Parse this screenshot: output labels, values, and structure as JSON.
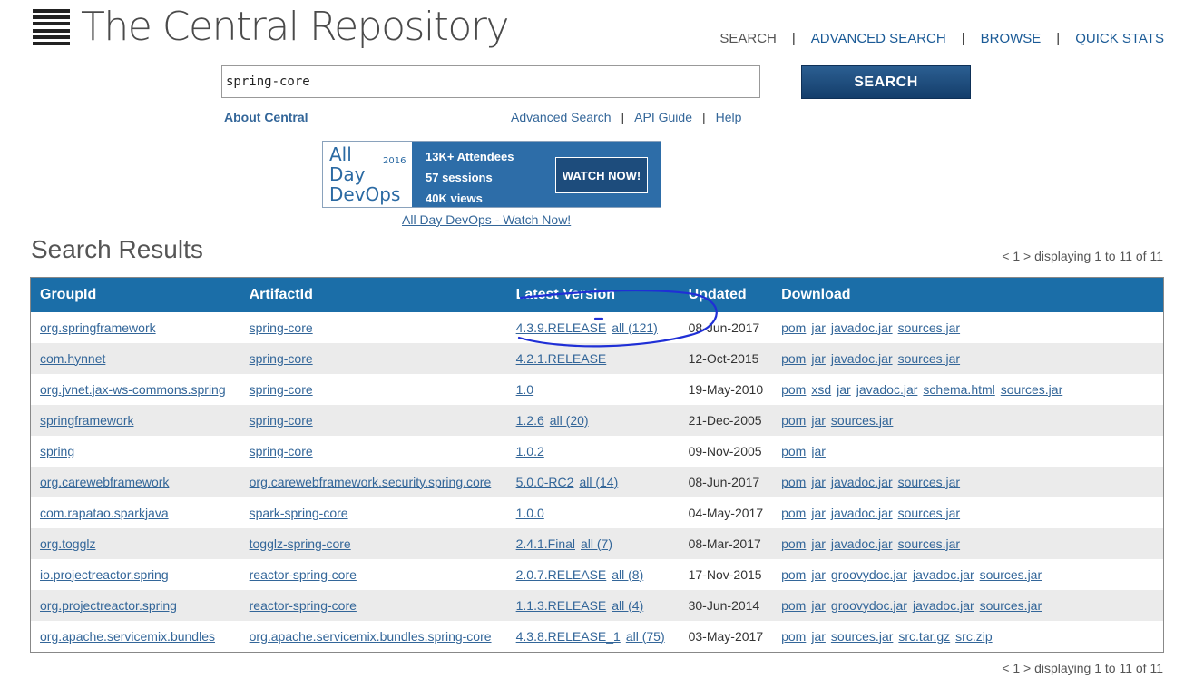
{
  "header": {
    "site_title": "The Central Repository",
    "nav": [
      "SEARCH",
      "ADVANCED SEARCH",
      "BROWSE",
      "QUICK STATS"
    ]
  },
  "search": {
    "value": "spring-core",
    "button_label": "SEARCH"
  },
  "links": {
    "about": "About Central",
    "advanced": "Advanced Search",
    "api": "API Guide",
    "help": "Help"
  },
  "banner": {
    "logo_line1": "All",
    "logo_line2": "Day",
    "logo_line3": "DevOps",
    "year": "2016",
    "stat1": "13K+ Attendees",
    "stat2": "57 sessions",
    "stat3": "40K views",
    "cta": "WATCH NOW!",
    "caption": "All Day DevOps - Watch Now!"
  },
  "results": {
    "title": "Search Results",
    "pager": "< 1 > displaying 1 to 11 of 11",
    "columns": [
      "GroupId",
      "ArtifactId",
      "Latest Version",
      "Updated",
      "Download"
    ],
    "rows": [
      {
        "group": "org.springframework",
        "artifact": "spring-core",
        "version": "4.3.9.RELEASE",
        "all": "all (121)",
        "updated": "08-Jun-2017",
        "downloads": [
          "pom",
          "jar",
          "javadoc.jar",
          "sources.jar"
        ]
      },
      {
        "group": "com.hynnet",
        "artifact": "spring-core",
        "version": "4.2.1.RELEASE",
        "all": "",
        "updated": "12-Oct-2015",
        "downloads": [
          "pom",
          "jar",
          "javadoc.jar",
          "sources.jar"
        ]
      },
      {
        "group": "org.jvnet.jax-ws-commons.spring",
        "artifact": "spring-core",
        "version": "1.0",
        "all": "",
        "updated": "19-May-2010",
        "downloads": [
          "pom",
          "xsd",
          "jar",
          "javadoc.jar",
          "schema.html",
          "sources.jar"
        ]
      },
      {
        "group": "springframework",
        "artifact": "spring-core",
        "version": "1.2.6",
        "all": "all (20)",
        "updated": "21-Dec-2005",
        "downloads": [
          "pom",
          "jar",
          "sources.jar"
        ]
      },
      {
        "group": "spring",
        "artifact": "spring-core",
        "version": "1.0.2",
        "all": "",
        "updated": "09-Nov-2005",
        "downloads": [
          "pom",
          "jar"
        ]
      },
      {
        "group": "org.carewebframework",
        "artifact": "org.carewebframework.security.spring.core",
        "version": "5.0.0-RC2",
        "all": "all (14)",
        "updated": "08-Jun-2017",
        "downloads": [
          "pom",
          "jar",
          "javadoc.jar",
          "sources.jar"
        ]
      },
      {
        "group": "com.rapatao.sparkjava",
        "artifact": "spark-spring-core",
        "version": "1.0.0",
        "all": "",
        "updated": "04-May-2017",
        "downloads": [
          "pom",
          "jar",
          "javadoc.jar",
          "sources.jar"
        ]
      },
      {
        "group": "org.togglz",
        "artifact": "togglz-spring-core",
        "version": "2.4.1.Final",
        "all": "all (7)",
        "updated": "08-Mar-2017",
        "downloads": [
          "pom",
          "jar",
          "javadoc.jar",
          "sources.jar"
        ]
      },
      {
        "group": "io.projectreactor.spring",
        "artifact": "reactor-spring-core",
        "version": "2.0.7.RELEASE",
        "all": "all (8)",
        "updated": "17-Nov-2015",
        "downloads": [
          "pom",
          "jar",
          "groovydoc.jar",
          "javadoc.jar",
          "sources.jar"
        ]
      },
      {
        "group": "org.projectreactor.spring",
        "artifact": "reactor-spring-core",
        "version": "1.1.3.RELEASE",
        "all": "all (4)",
        "updated": "30-Jun-2014",
        "downloads": [
          "pom",
          "jar",
          "groovydoc.jar",
          "javadoc.jar",
          "sources.jar"
        ]
      },
      {
        "group": "org.apache.servicemix.bundles",
        "artifact": "org.apache.servicemix.bundles.spring-core",
        "version": "4.3.8.RELEASE_1",
        "all": "all (75)",
        "updated": "03-May-2017",
        "downloads": [
          "pom",
          "jar",
          "sources.jar",
          "src.tar.gz",
          "src.zip"
        ]
      }
    ]
  },
  "colors": {
    "header_bg": "#1b6ea8",
    "link": "#336699",
    "button": "#1d4c7c",
    "annotation": "#1f2fd6"
  }
}
